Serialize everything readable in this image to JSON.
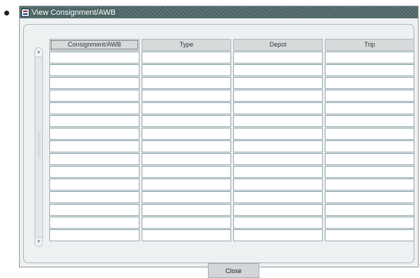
{
  "window": {
    "title": "View Consignment/AWB"
  },
  "table": {
    "columns": [
      "Consignment/AWB",
      "Type",
      "Depot",
      "Trip"
    ],
    "active_column": 0,
    "rows": [
      [
        "",
        "",
        "",
        ""
      ],
      [
        "",
        "",
        "",
        ""
      ],
      [
        "",
        "",
        "",
        ""
      ],
      [
        "",
        "",
        "",
        ""
      ],
      [
        "",
        "",
        "",
        ""
      ],
      [
        "",
        "",
        "",
        ""
      ],
      [
        "",
        "",
        "",
        ""
      ],
      [
        "",
        "",
        "",
        ""
      ],
      [
        "",
        "",
        "",
        ""
      ],
      [
        "",
        "",
        "",
        ""
      ],
      [
        "",
        "",
        "",
        ""
      ],
      [
        "",
        "",
        "",
        ""
      ],
      [
        "",
        "",
        "",
        ""
      ],
      [
        "",
        "",
        "",
        ""
      ],
      [
        "",
        "",
        "",
        ""
      ]
    ]
  },
  "scrollbar": {
    "up_icon": "scroll-up-arrow",
    "down_icon": "scroll-down-arrow"
  },
  "buttons": {
    "close": "Close"
  },
  "colors": {
    "titlebar": "#4c6464",
    "cell_border": "#96a9ae",
    "panel_bg": "#eef1f2"
  }
}
